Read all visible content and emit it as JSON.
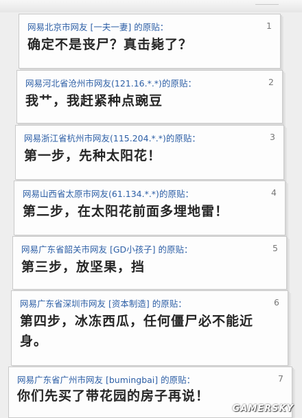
{
  "posts": [
    {
      "header": "网易北京市网友 [一夫一妻] 的原贴：",
      "floor": "1",
      "body": "确定不是丧尸？真击毙了？"
    },
    {
      "header": "网易河北省沧州市网友(121.16.*.*)的原贴：",
      "floor": "2",
      "body": "我艹，我赶紧种点豌豆"
    },
    {
      "header": "网易浙江省杭州市网友(115.204.*.*)的原贴：",
      "floor": "3",
      "body": "第一步，先种太阳花！"
    },
    {
      "header": "网易山西省太原市网友(61.134.*.*)的原贴：",
      "floor": "4",
      "body": "第二步，在太阳花前面多埋地雷！"
    },
    {
      "header": "网易广东省韶关市网友 [GD小孩子] 的原贴：",
      "floor": "5",
      "body": "第三步，放坚果，挡"
    },
    {
      "header": "网易广东省深圳市网友 [资本制造] 的原贴：",
      "floor": "6",
      "body": "第四步，冰冻西瓜，任何僵尸必不能近身。"
    },
    {
      "header": "网易广东省广州市网友 [bumingbai] 的原贴：",
      "floor": "7",
      "body": "你们先买了带花园的房子再说！"
    }
  ],
  "watermark": "GAMERSKY"
}
